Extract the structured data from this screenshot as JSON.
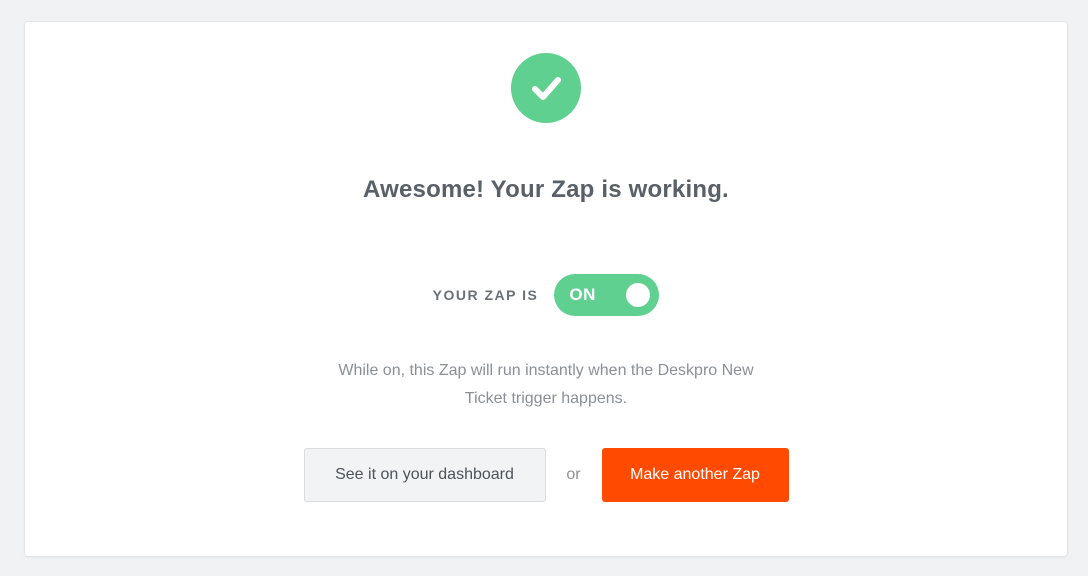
{
  "success": {
    "icon": "checkmark-circle-icon",
    "headline": "Awesome! Your Zap is working."
  },
  "status": {
    "label": "YOUR ZAP IS",
    "toggle_text": "ON",
    "is_on": true
  },
  "description": {
    "line1": "While on, this Zap will run instantly when the Deskpro New",
    "line2": "Ticket trigger happens."
  },
  "actions": {
    "dashboard_label": "See it on your dashboard",
    "or_label": "or",
    "make_another_label": "Make another Zap"
  },
  "colors": {
    "success_green": "#5fd08f",
    "zapier_orange": "#ff4a00",
    "text_dark": "#596068",
    "text_muted": "#8b9096"
  }
}
